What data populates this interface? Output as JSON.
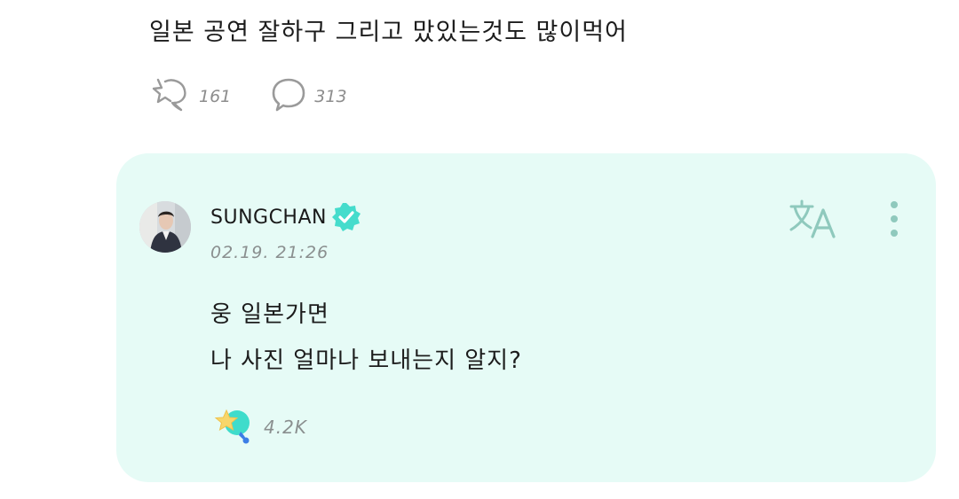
{
  "post": {
    "text": "일본 공연 잘하구 그리고 맜있는것도 많이먹어",
    "likes_count": "161",
    "comments_count": "313"
  },
  "reply": {
    "author": "SUNGCHAN",
    "timestamp": "02.19. 21:26",
    "lines": [
      "웅 일본가면",
      "나 사진 얼마나 보내는지 알지?"
    ],
    "reaction_count": "4.2K"
  },
  "colors": {
    "card_bg": "#e6fbf6",
    "accent": "#3fdccb",
    "icon_gray": "#8a8f8f"
  },
  "icons": [
    "star-like-icon",
    "comment-bubble-icon",
    "verified-badge-icon",
    "translate-icon",
    "more-vertical-icon",
    "star-reaction-icon"
  ]
}
